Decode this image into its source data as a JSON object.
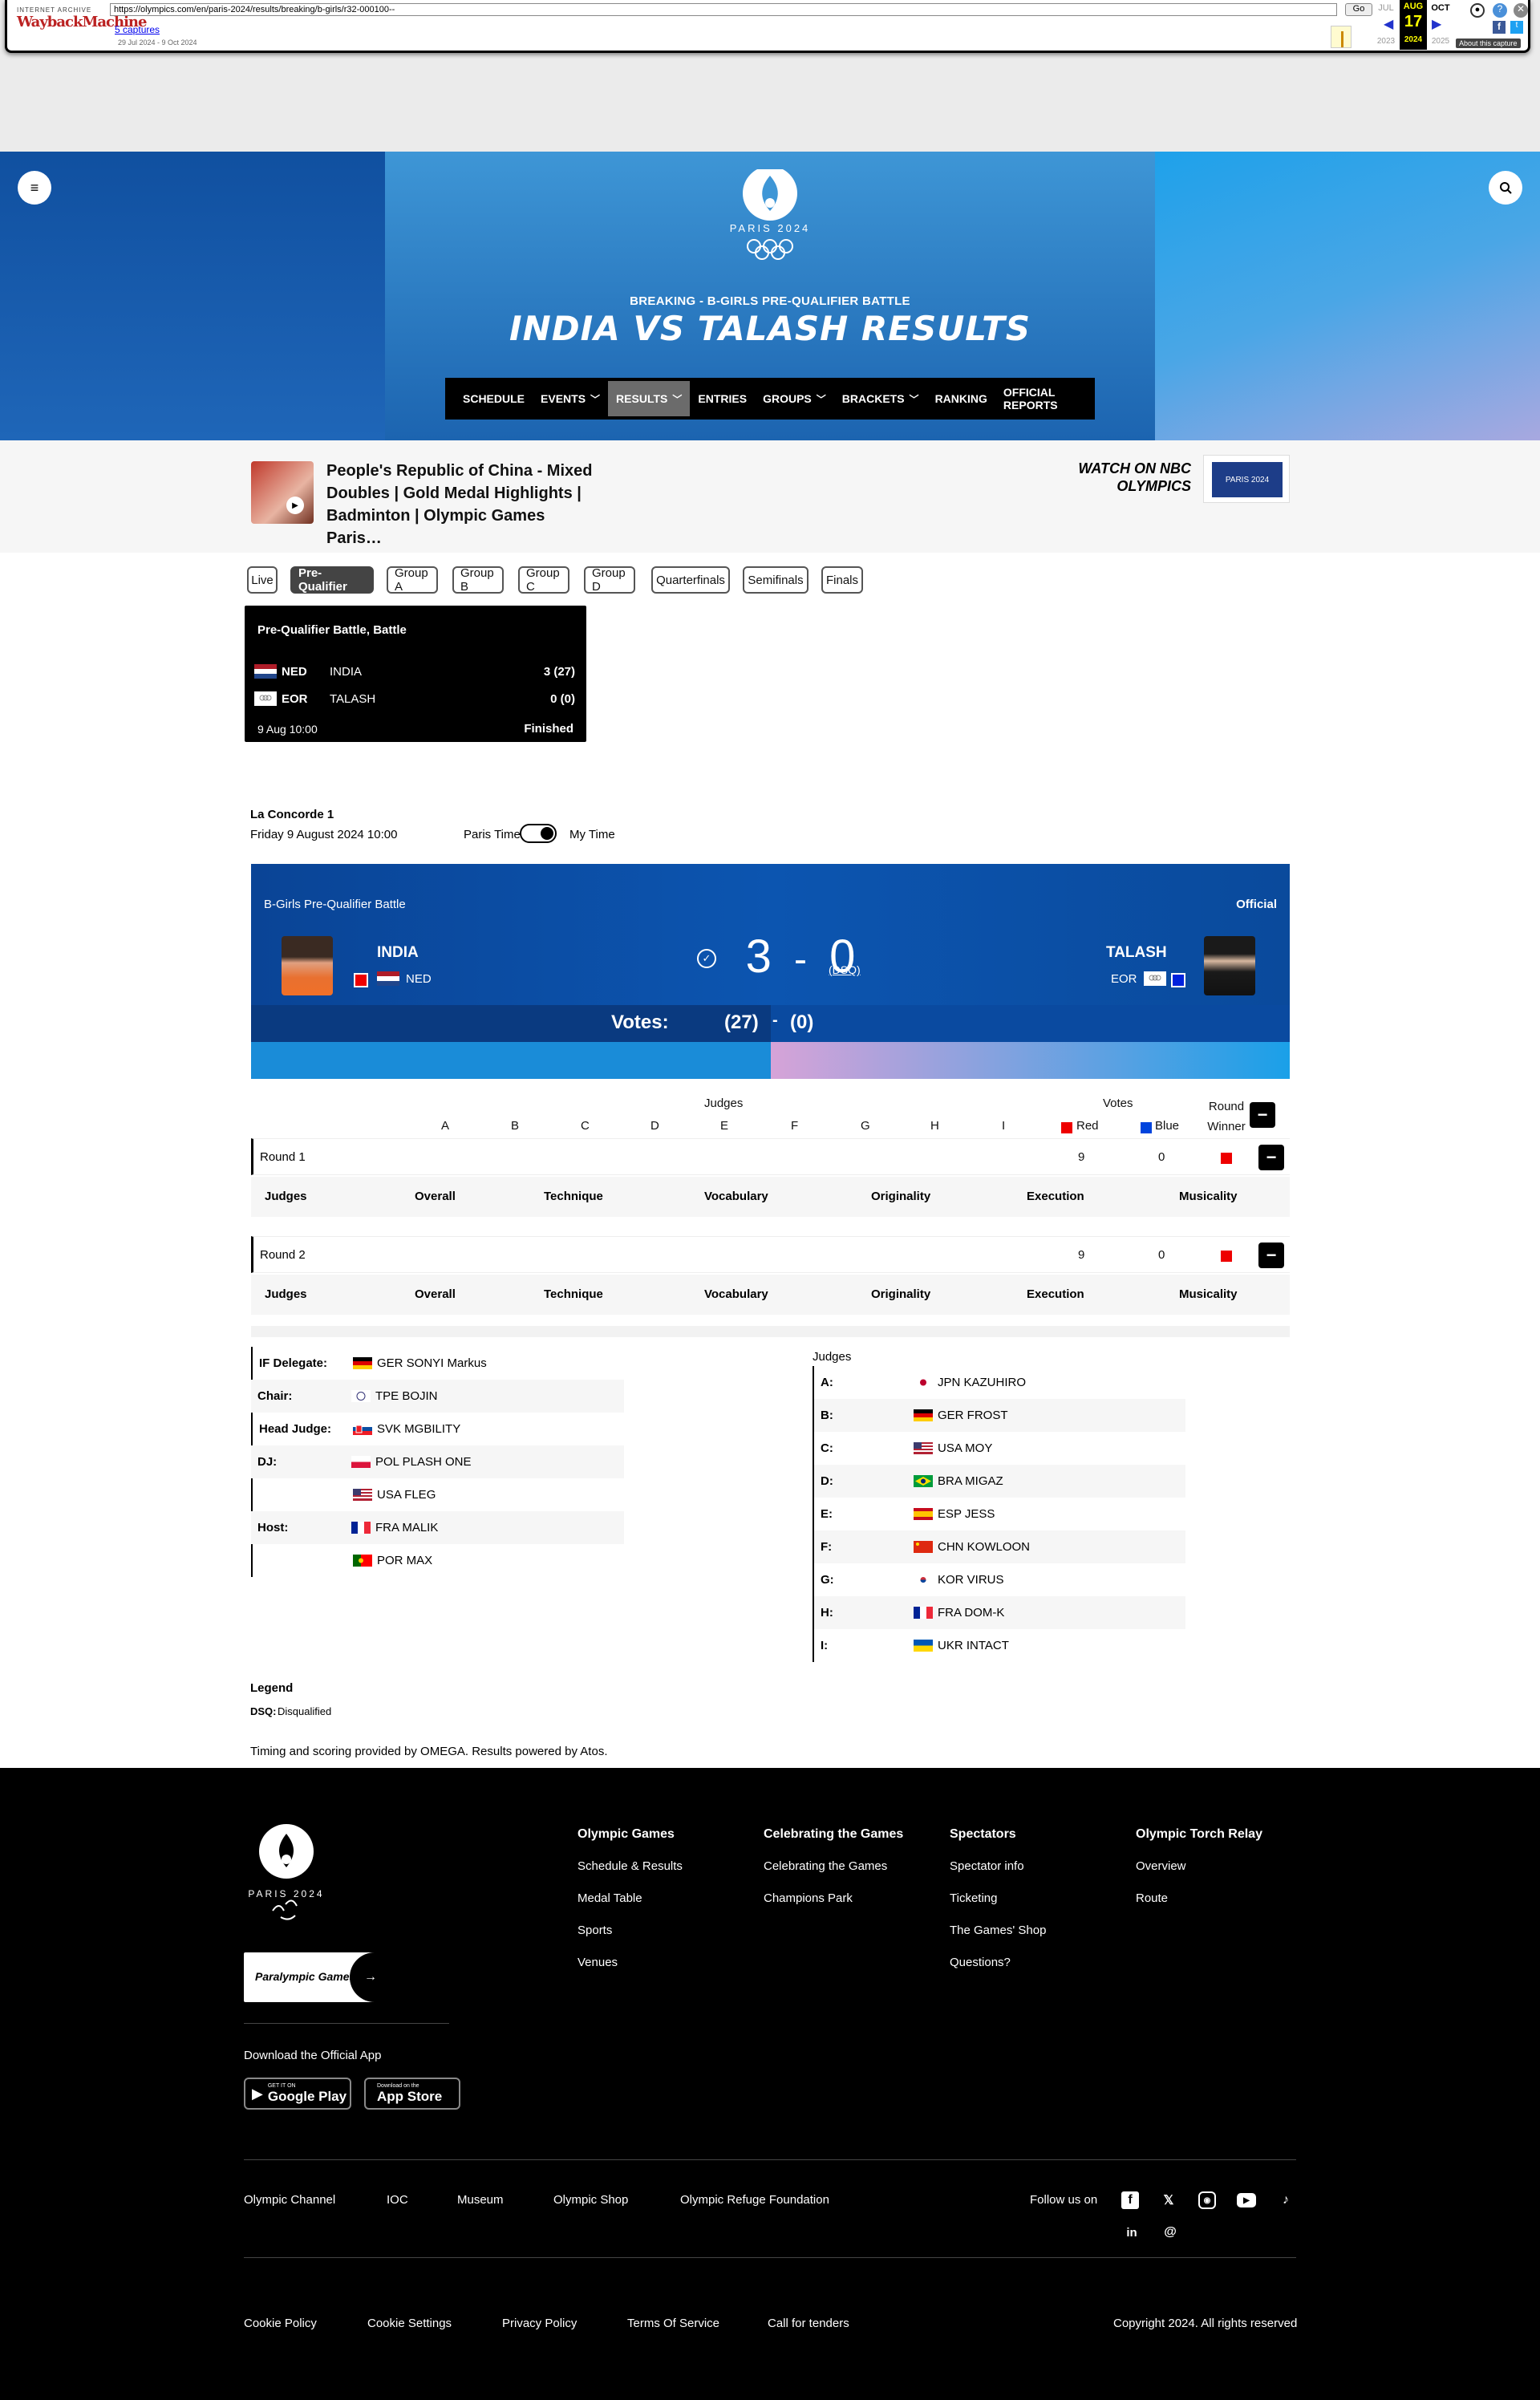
{
  "wayback": {
    "logo_small": "INTERNET ARCHIVE",
    "logo_big": "WaybackMachine",
    "url": "https://olympics.com/en/paris-2024/results/breaking/b-girls/r32-000100--",
    "go": "Go",
    "captures": "5 captures",
    "range": "29 Jul 2024 - 9 Oct 2024",
    "months": [
      "JUL",
      "AUG",
      "OCT"
    ],
    "day": "17",
    "years": [
      "2023",
      "2024",
      "2025"
    ],
    "about": "About this capture"
  },
  "hero": {
    "brand": "PARIS 2024",
    "subtitle": "BREAKING - B-GIRLS PRE-QUALIFIER BATTLE",
    "title": "INDIA VS TALASH RESULTS",
    "nav": [
      {
        "label": "SCHEDULE"
      },
      {
        "label": "EVENTS"
      },
      {
        "label": "RESULTS"
      },
      {
        "label": "ENTRIES"
      },
      {
        "label": "GROUPS"
      },
      {
        "label": "BRACKETS"
      },
      {
        "label": "RANKING"
      },
      {
        "label": "OFFICIAL REPORTS"
      }
    ]
  },
  "video": {
    "title": "People's Republic of China - Mixed Doubles | Gold Medal Highlights | Badminton | Olympic Games Paris…",
    "watch": "WATCH ON NBC OLYMPICS",
    "nbc_logo": "PARIS 2024"
  },
  "stages": [
    "Live",
    "Pre-Qualifier",
    "Group A",
    "Group B",
    "Group C",
    "Group D",
    "Quarterfinals",
    "Semifinals",
    "Finals"
  ],
  "match_card": {
    "title": "Pre-Qualifier Battle, Battle",
    "rows": [
      {
        "code": "NED",
        "name": "INDIA",
        "score": "3 (27)"
      },
      {
        "code": "EOR",
        "name": "TALASH",
        "score": "0 (0)"
      }
    ],
    "time": "9 Aug 10:00",
    "status": "Finished"
  },
  "venue": {
    "name": "La Concorde 1",
    "date": "Friday 9 August 2024 10:00",
    "paris_time": "Paris Time",
    "my_time": "My Time"
  },
  "scoreboard": {
    "event": "B-Girls Pre-Qualifier Battle",
    "status": "Official",
    "home": {
      "name": "INDIA",
      "noc": "NED"
    },
    "away": {
      "name": "TALASH",
      "noc": "EOR"
    },
    "score_home": "3",
    "dash": "-",
    "score_away": "0",
    "dsq": "(DSQ)",
    "votes_label": "Votes:",
    "votes_home": "(27)",
    "votes_away": "(0)"
  },
  "judges_table": {
    "judges_label": "Judges",
    "votes_label": "Votes",
    "round_winner": "Round Winner",
    "letters": [
      "A",
      "B",
      "C",
      "D",
      "E",
      "F",
      "G",
      "H",
      "I"
    ],
    "red": "Red",
    "blue": "Blue",
    "rounds": [
      {
        "label": "Round 1",
        "red": "9",
        "blue": "0"
      },
      {
        "label": "Round 2",
        "red": "9",
        "blue": "0"
      }
    ],
    "criteria": [
      "Judges",
      "Overall",
      "Technique",
      "Vocabulary",
      "Originality",
      "Execution",
      "Musicality"
    ]
  },
  "officials": [
    {
      "role": "IF Delegate:",
      "name": "GER SONYI Markus"
    },
    {
      "role": "Chair:",
      "name": "TPE BOJIN"
    },
    {
      "role": "Head Judge:",
      "name": "SVK MGBILITY"
    },
    {
      "role": "DJ:",
      "name": "POL PLASH ONE"
    },
    {
      "role": "",
      "name": "USA FLEG"
    },
    {
      "role": "Host:",
      "name": "FRA MALIK"
    },
    {
      "role": "",
      "name": "POR MAX"
    }
  ],
  "judges_list": {
    "title": "Judges",
    "items": [
      {
        "letter": "A:",
        "name": "JPN KAZUHIRO"
      },
      {
        "letter": "B:",
        "name": "GER FROST"
      },
      {
        "letter": "C:",
        "name": "USA MOY"
      },
      {
        "letter": "D:",
        "name": "BRA MIGAZ"
      },
      {
        "letter": "E:",
        "name": "ESP JESS"
      },
      {
        "letter": "F:",
        "name": "CHN KOWLOON"
      },
      {
        "letter": "G:",
        "name": "KOR VIRUS"
      },
      {
        "letter": "H:",
        "name": "FRA DOM-K"
      },
      {
        "letter": "I:",
        "name": "UKR INTACT"
      }
    ]
  },
  "legend": {
    "title": "Legend",
    "key": "DSQ:",
    "value": "Disqualified",
    "credit": "Timing and scoring provided by OMEGA. Results powered by Atos."
  },
  "footer": {
    "brand": "PARIS 2024",
    "paralympic": "Paralympic Games",
    "download": "Download the Official App",
    "google_small": "GET IT ON",
    "google": "Google Play",
    "apple_small": "Download on the",
    "apple": "App Store",
    "columns": [
      {
        "title": "Olympic Games",
        "links": [
          "Schedule & Results",
          "Medal Table",
          "Sports",
          "Venues"
        ]
      },
      {
        "title": "Celebrating the Games",
        "links": [
          "Celebrating the Games",
          "Champions Park"
        ]
      },
      {
        "title": "Spectators",
        "links": [
          "Spectator info",
          "Ticketing",
          "The Games' Shop",
          "Questions?"
        ]
      },
      {
        "title": "Olympic Torch Relay",
        "links": [
          "Overview",
          "Route"
        ]
      }
    ],
    "bottom_links": [
      "Olympic Channel",
      "IOC",
      "Museum",
      "Olympic Shop",
      "Olympic Refuge Foundation"
    ],
    "follow": "Follow us on",
    "legal": [
      "Cookie Policy",
      "Cookie Settings",
      "Privacy Policy",
      "Terms Of Service",
      "Call for tenders"
    ],
    "copyright": "Copyright 2024. All rights reserved"
  }
}
